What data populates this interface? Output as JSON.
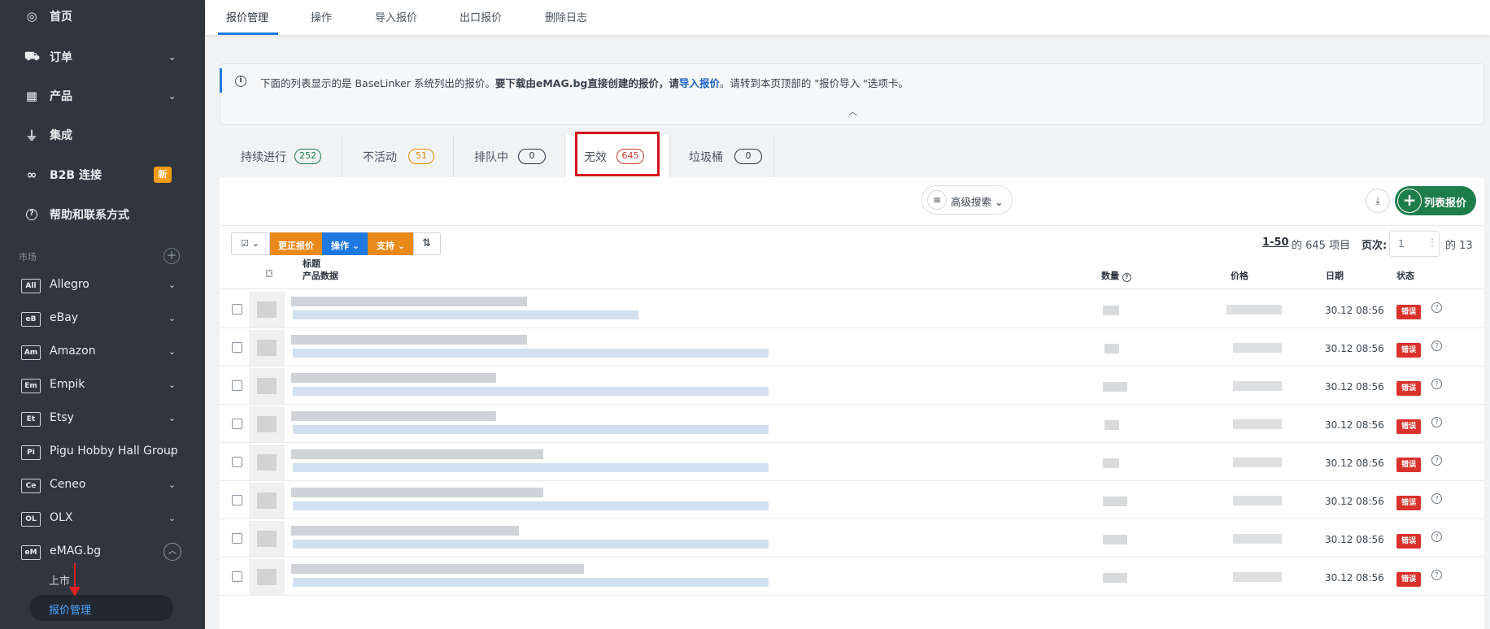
{
  "sidebar": {
    "items": [
      {
        "label": "首页",
        "icon": "dashboard-icon",
        "glyph": "◎"
      },
      {
        "label": "订单",
        "icon": "cart-icon",
        "glyph": "🛒"
      },
      {
        "label": "产品",
        "icon": "products-icon",
        "glyph": "▦"
      },
      {
        "label": "集成",
        "icon": "plug-icon",
        "glyph": "⏚"
      },
      {
        "label": "B2B 连接",
        "icon": "link-icon",
        "glyph": "∞",
        "badge": "新"
      },
      {
        "label": "帮助和联系方式",
        "icon": "help-icon",
        "glyph": "?"
      }
    ],
    "section_label": "市场",
    "marketplaces": [
      {
        "code": "All",
        "label": "Allegro"
      },
      {
        "code": "eB",
        "label": "eBay"
      },
      {
        "code": "Am",
        "label": "Amazon"
      },
      {
        "code": "Em",
        "label": "Empik"
      },
      {
        "code": "Et",
        "label": "Etsy"
      },
      {
        "code": "Pi",
        "label": "Pigu Hobby Hall Group"
      },
      {
        "code": "Ce",
        "label": "Ceneo"
      },
      {
        "code": "OL",
        "label": "OLX"
      },
      {
        "code": "eM",
        "label": "eMAG.bg"
      }
    ],
    "sub_items": [
      "上市",
      "报价管理"
    ]
  },
  "top_tabs": [
    "报价管理",
    "操作",
    "导入报价",
    "出口报价",
    "删除日志"
  ],
  "info": {
    "text_plain": "下面的列表显示的是 BaseLinker 系统列出的报价。",
    "text_bold": "要下载由eMAG.bg直接创建的报价，请",
    "link": "导入报价",
    "text_tail": "。请转到本页顶部的 \"报价导入 \"选项卡。"
  },
  "status_tabs": [
    {
      "label": "持续进行",
      "count": "252",
      "color": "#1e7e4b"
    },
    {
      "label": "不活动",
      "count": "51",
      "color": "#e68a00"
    },
    {
      "label": "排队中",
      "count": "0",
      "color": "#2c3440"
    },
    {
      "label": "无效",
      "count": "645",
      "color": "#c0392b"
    },
    {
      "label": "垃圾桶",
      "count": "0",
      "color": "#2c3440"
    }
  ],
  "panel": {
    "advanced_search": "高级搜索",
    "add_offer": "列表报价",
    "toolbar": {
      "update": "更正报价",
      "actions": "操作",
      "support": "支持"
    },
    "pagination": {
      "range": "1-50",
      "of_items": "的 645 项目",
      "page_label": "页次:",
      "page_value": "1",
      "of_pages": "的 13"
    },
    "columns": {
      "title": "标题",
      "product_data": "产品数据",
      "quantity": "数量",
      "price": "价格",
      "date": "日期",
      "status": "状态"
    },
    "rows": [
      {
        "date": "30.12 08:56",
        "status": "错误"
      },
      {
        "date": "30.12 08:56",
        "status": "错误"
      },
      {
        "date": "30.12 08:56",
        "status": "错误"
      },
      {
        "date": "30.12 08:56",
        "status": "错误"
      },
      {
        "date": "30.12 08:56",
        "status": "错误"
      },
      {
        "date": "30.12 08:56",
        "status": "错误"
      },
      {
        "date": "30.12 08:56",
        "status": "错误"
      },
      {
        "date": "30.12 08:56",
        "status": "错误"
      }
    ]
  }
}
